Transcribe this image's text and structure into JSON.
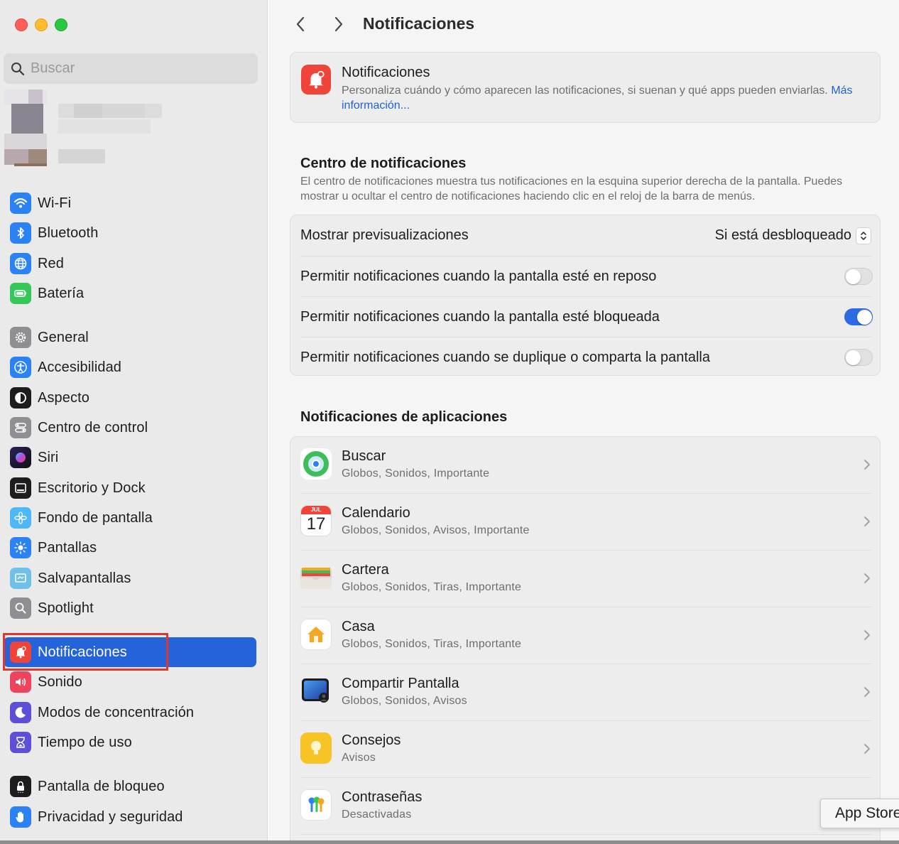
{
  "window": {
    "title": "Notificaciones"
  },
  "search": {
    "placeholder": "Buscar"
  },
  "sidebar": {
    "groups": [
      [
        {
          "label": "Wi-Fi",
          "icon": "wifi-icon",
          "color": "#2b82f5"
        },
        {
          "label": "Bluetooth",
          "icon": "bluetooth-icon",
          "color": "#2b82f5"
        },
        {
          "label": "Red",
          "icon": "network-globe-icon",
          "color": "#2b82f5"
        },
        {
          "label": "Batería",
          "icon": "battery-icon",
          "color": "#35c759"
        }
      ],
      [
        {
          "label": "General",
          "icon": "gear-icon",
          "color": "#8e8e93"
        },
        {
          "label": "Accesibilidad",
          "icon": "accessibility-icon",
          "color": "#2b82f5"
        },
        {
          "label": "Aspecto",
          "icon": "appearance-icon",
          "color": "#1d1d1f"
        },
        {
          "label": "Centro de control",
          "icon": "control-center-icon",
          "color": "#8e8e93"
        },
        {
          "label": "Siri",
          "icon": "siri-icon",
          "color": "#6a3cc8"
        },
        {
          "label": "Escritorio y Dock",
          "icon": "dock-icon",
          "color": "#1d1d1f"
        },
        {
          "label": "Fondo de pantalla",
          "icon": "wallpaper-flower-icon",
          "color": "#4fb7f5"
        },
        {
          "label": "Pantallas",
          "icon": "display-sun-icon",
          "color": "#2b82f5"
        },
        {
          "label": "Salvapantallas",
          "icon": "screensaver-icon",
          "color": "#6fc1ea"
        },
        {
          "label": "Spotlight",
          "icon": "spotlight-magnifier-icon",
          "color": "#8e8e93"
        }
      ],
      [
        {
          "label": "Notificaciones",
          "icon": "notification-bell-icon",
          "color": "#f0443a",
          "active": true
        },
        {
          "label": "Sonido",
          "icon": "speaker-icon",
          "color": "#f0445e"
        },
        {
          "label": "Modos de concentración",
          "icon": "moon-icon",
          "color": "#5e4fd8"
        },
        {
          "label": "Tiempo de uso",
          "icon": "hourglass-icon",
          "color": "#5e4fd8"
        }
      ],
      [
        {
          "label": "Pantalla de bloqueo",
          "icon": "lock-screen-icon",
          "color": "#1d1d1f"
        },
        {
          "label": "Privacidad y seguridad",
          "icon": "hand-icon",
          "color": "#2b82f5"
        }
      ]
    ]
  },
  "header_card": {
    "title": "Notificaciones",
    "description": "Personaliza cuándo y cómo aparecen las notificaciones, si suenan y qué apps pueden enviarlas.",
    "link": "Más información..."
  },
  "notification_center": {
    "title": "Centro de notificaciones",
    "description": "El centro de notificaciones muestra tus notificaciones en la esquina superior derecha de la pantalla. Puedes mostrar u ocultar el centro de notificaciones haciendo clic en el reloj de la barra de menús.",
    "preview_label": "Mostrar previsualizaciones",
    "preview_value": "Si está desbloqueado",
    "toggles": [
      {
        "label": "Permitir notificaciones cuando la pantalla esté en reposo",
        "on": false
      },
      {
        "label": "Permitir notificaciones cuando la pantalla esté bloqueada",
        "on": true
      },
      {
        "label": "Permitir notificaciones cuando se duplique o comparta la pantalla",
        "on": false
      }
    ]
  },
  "app_notifications": {
    "title": "Notificaciones de aplicaciones",
    "calendar_month": "JUL",
    "calendar_day": "17",
    "apps": [
      {
        "name": "Buscar",
        "detail": "Globos, Sonidos, Importante",
        "icon": "find-my-icon"
      },
      {
        "name": "Calendario",
        "detail": "Globos, Sonidos, Avisos, Importante",
        "icon": "calendar-icon"
      },
      {
        "name": "Cartera",
        "detail": "Globos, Sonidos, Tiras, Importante",
        "icon": "wallet-icon"
      },
      {
        "name": "Casa",
        "detail": "Globos, Sonidos, Tiras, Importante",
        "icon": "home-icon"
      },
      {
        "name": "Compartir Pantalla",
        "detail": "Globos, Sonidos, Avisos",
        "icon": "screen-sharing-icon"
      },
      {
        "name": "Consejos",
        "detail": "Avisos",
        "icon": "tips-bulb-icon"
      },
      {
        "name": "Contraseñas",
        "detail": "Desactivadas",
        "icon": "passwords-key-icon"
      }
    ]
  },
  "tooltip": {
    "text": "App Store"
  }
}
